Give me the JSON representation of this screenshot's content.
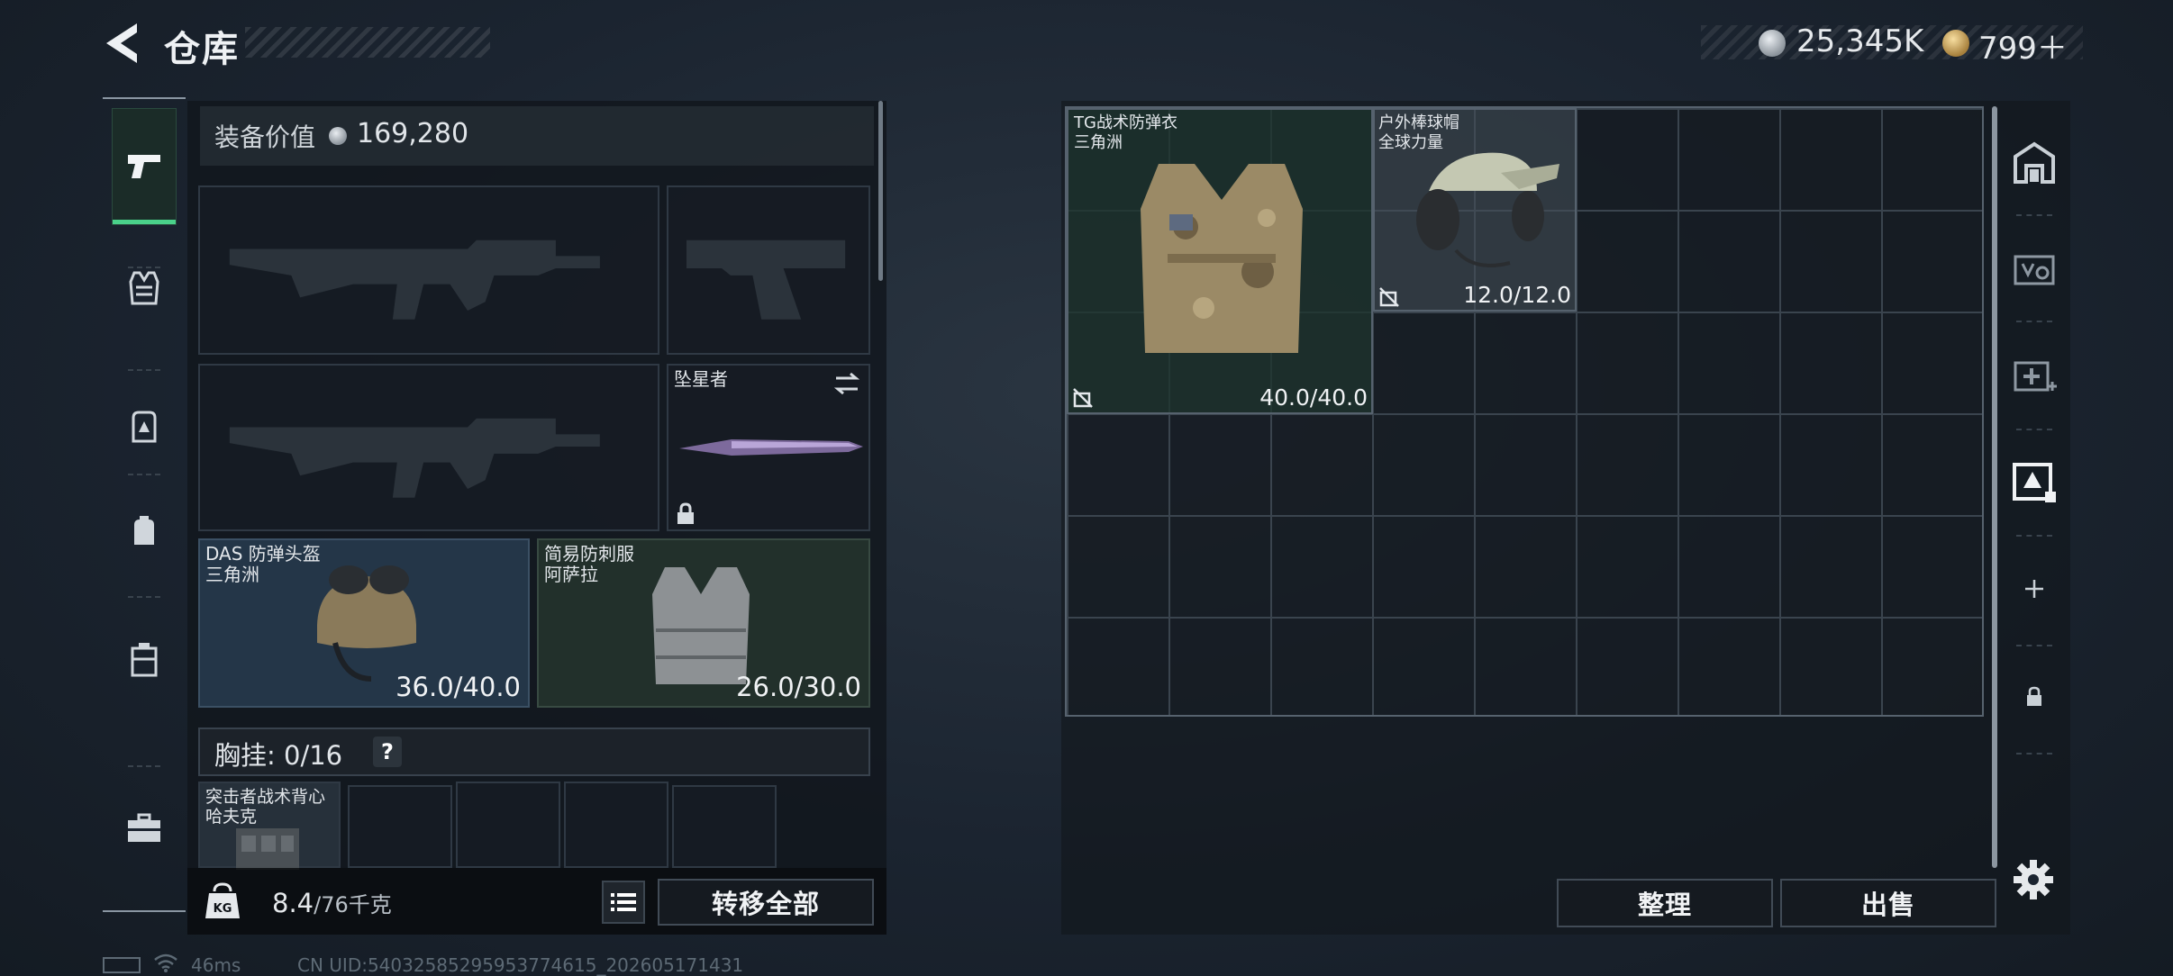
{
  "header": {
    "title": "仓库",
    "currency_silver": "25,345K",
    "currency_gold": "799＋"
  },
  "equipment": {
    "value_label": "装备价值",
    "value_amount": "169,280",
    "melee_name": "坠星者",
    "helmet": {
      "name": "DAS 防弹头盔",
      "origin": "三角洲",
      "durability": "36.0/40.0"
    },
    "armor": {
      "name": "简易防刺服",
      "origin": "阿萨拉",
      "durability": "26.0/30.0"
    },
    "chest_rig_label": "胸挂: 0/16",
    "help_label": "?",
    "rig_item": {
      "name": "突击者战术背心",
      "origin": "哈夫克"
    },
    "weight_current": "8.4",
    "weight_max": "/76千克",
    "transfer_all_label": "转移全部"
  },
  "stash": {
    "items": [
      {
        "name": "TG战术防弹衣",
        "origin": "三角洲",
        "durability": "40.0/40.0"
      },
      {
        "name": "户外棒球帽",
        "origin": "全球力量",
        "durability": "12.0/12.0"
      }
    ],
    "sort_label": "整理",
    "sell_label": "出售"
  },
  "status": {
    "ping": "46ms",
    "uid": "CN UID:54032585295953774615_202605171431"
  },
  "colors": {
    "active_tab_accent": "#4ad18a",
    "blue_rarity": "#243648",
    "green_rarity": "#22302b"
  },
  "icons": {
    "left_nav": [
      "pistol-icon",
      "vest-icon",
      "backpack-icon",
      "pouch-icon",
      "container-icon",
      "toolbox-icon"
    ],
    "right_nav": [
      "house-icon",
      "case-icon",
      "medkit-icon",
      "ammo-box-icon",
      "plus-icon",
      "lock-icon"
    ]
  }
}
